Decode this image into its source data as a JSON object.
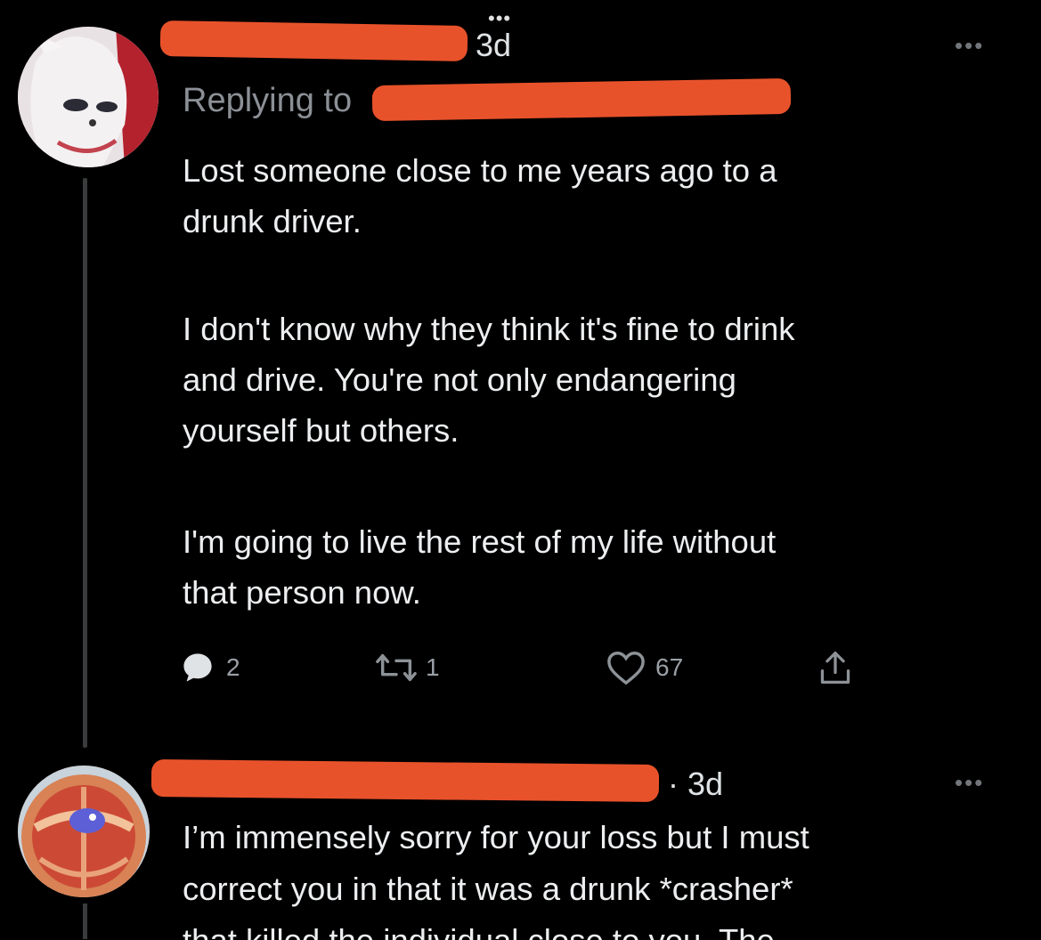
{
  "tweet1": {
    "time": "3d",
    "replying_prefix": "Replying to",
    "paragraphs": [
      [
        "Lost someone close to me years ago to a",
        "drunk driver."
      ],
      [
        "I don't know why they think it's fine to drink",
        "and drive. You're not only endangering",
        "yourself but others."
      ],
      [
        "I'm going to live the rest of my life without",
        "that person now."
      ]
    ],
    "actions": {
      "replies": "2",
      "retweets": "1",
      "likes": "67"
    },
    "more_label": "•••",
    "top_dots": "•••"
  },
  "tweet2": {
    "time": "· 3d",
    "more_label": "•••",
    "lines": [
      "I’m immensely sorry for your loss but I must",
      "correct you in that it was a drunk *crasher*",
      "that killed the individual close to you. The"
    ]
  },
  "colors": {
    "background": "#000000",
    "text": "#e7e9ea",
    "muted": "#8b9096",
    "redaction": "#e8522b"
  }
}
